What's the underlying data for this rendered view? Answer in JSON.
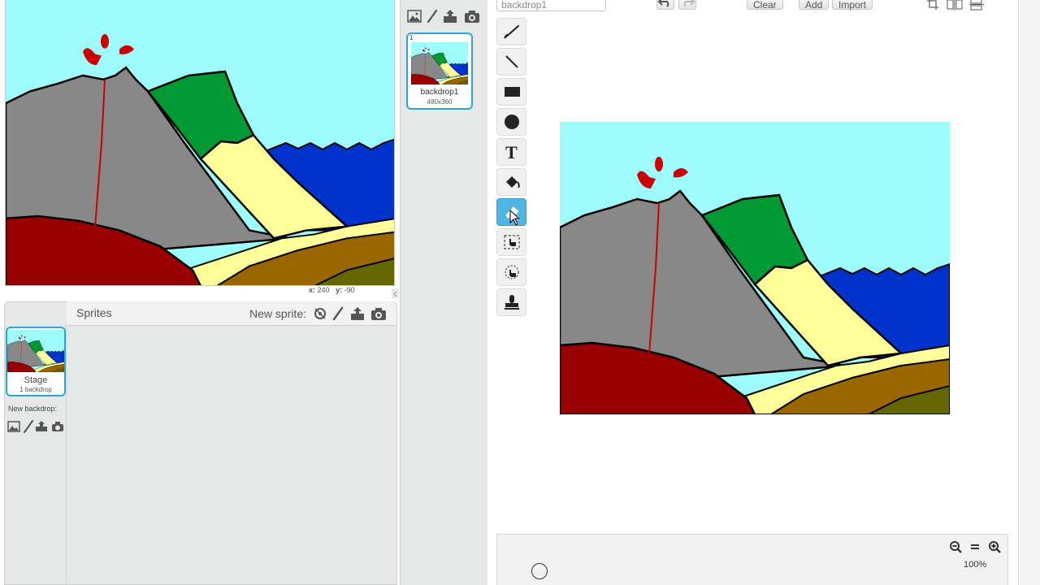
{
  "stage": {
    "coords_x_label": "x:",
    "coords_x_value": "240",
    "coords_y_label": "y:",
    "coords_y_value": "-90"
  },
  "sprites_pane": {
    "title": "Sprites",
    "new_sprite_label": "New sprite:",
    "stage_item": {
      "label": "Stage",
      "sub": "1 backdrop"
    },
    "new_backdrop_label": "New backdrop:"
  },
  "backdrops": [
    {
      "index": "1",
      "name": "backdrop1",
      "size": "480x360"
    }
  ],
  "editor": {
    "costume_name": "backdrop1",
    "clear_label": "Clear",
    "add_label": "Add",
    "import_label": "Import",
    "zoom_level": "100%",
    "active_tool": "eraser"
  },
  "icons": {
    "backdrop_tools": [
      "landscape-icon",
      "paintbrush-icon",
      "upload-icon",
      "camera-icon"
    ],
    "paint_tools": [
      "paintbrush-icon",
      "line-icon",
      "rectangle-icon",
      "ellipse-icon",
      "text-icon",
      "fill-bucket-icon",
      "eraser-icon",
      "select-icon",
      "reshape-icon",
      "stamp-icon"
    ]
  },
  "colors": {
    "accent": "#2aa6d6",
    "active_tool": "#4fb5e5",
    "sky": "#9efcfc",
    "gray_mountain": "#888888",
    "green": "#009933",
    "sand": "#ffff99",
    "ocean": "#0033cc",
    "lava_red": "#990000",
    "brown": "#996600",
    "olive": "#666600"
  }
}
